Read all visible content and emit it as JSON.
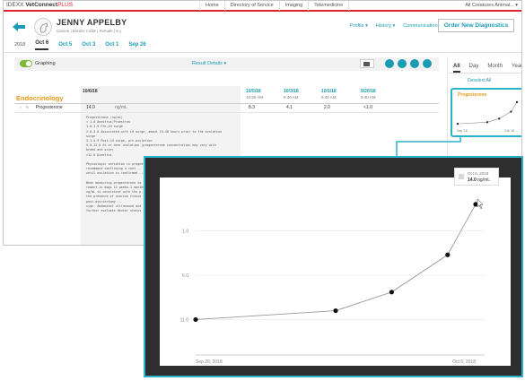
{
  "app": {
    "brand_prefix": "IDEXX",
    "brand_name": "VetConnect",
    "brand_suffix": "PLUS",
    "nav": [
      "Home",
      "Directory of Service",
      "Imaging",
      "Telemedicine"
    ],
    "clinic": "All Creatures Animal... ▾"
  },
  "patient": {
    "name": "JENNY APPELBY",
    "details": "Canine  |  Border Collie  |  Female  |  5 y"
  },
  "header_links": [
    "Profile ▾",
    "History ▾",
    "Communications ▾"
  ],
  "order_button": "Order New Diagnostics",
  "date_tabs": {
    "year": "2018",
    "tabs": [
      "Oct 6",
      "Oct 5",
      "Oct 3",
      "Oct 1",
      "Sep 26"
    ],
    "active": 0
  },
  "toolbar": {
    "graph_label": "Graphing",
    "result_details": "Result Details ▾"
  },
  "section": "Endocrinology",
  "columns": [
    {
      "date": "10/6/18",
      "time": ""
    },
    {
      "date": "10/5/18",
      "time": "10:36 AM"
    },
    {
      "date": "10/3/18",
      "time": "9:40 AM"
    },
    {
      "date": "10/1/18",
      "time": "9:40 AM"
    },
    {
      "date": "9/26/18",
      "time": "9:40 AM"
    }
  ],
  "test": {
    "name": "Progesterone",
    "unit": "ng/mL",
    "values": [
      "14.0",
      "8.3",
      "4.1",
      "2.0",
      "<1.0"
    ]
  },
  "notes": "Progesterone (ng/mL)\n< 1.0 Anestrus/Proestrus\n1.0-1.9 Pre-LH surge\n2.0-3.0 Associated with LH surge, about 24-48 hours prior to the ovulation\nsurge\n3.1-4.9 Post-LH surge, pre-ovulation\n5.0-12.0 At or near ovulation (progesterone concentration may vary with\nbreed and size)\n>12.0 Diestrus\n\nPhysiologic variation in progesterone ...\nrecommend confirming a cont...\nuntil ovulation is confirmed ...\n\nWhen measuring progesterone to ...\nrement in dogs 12 weeks-1 months ...\nng/mL is consistent with the p...\nthe presence of ovarian tissue ...\npost-ovariectomy ...\nsign. Abdominal ultrasound and ...\nfurther evaluate Heuter status ...",
  "right_panel": {
    "tabs": [
      "All",
      "Day",
      "Month",
      "Year"
    ],
    "active_tab": 0,
    "deselect": "Deselect All",
    "card_title": "Progesterone",
    "card_start": "Sep '18",
    "card_end": "Oct '18"
  },
  "zoom_chart": {
    "tooltip_date": "Oct 6, 2018",
    "tooltip_value": "14.0",
    "tooltip_unit": "ng/mL",
    "y_ticks": [
      "11.0",
      "6.0",
      "1.0"
    ],
    "x_start": "Sep 26, 2018",
    "x_end": "Oct 6, 2018"
  },
  "chart_data": {
    "type": "line",
    "title": "Progesterone",
    "xlabel": "",
    "ylabel": "",
    "x": [
      "2018-09-26",
      "2018-10-01",
      "2018-10-03",
      "2018-10-05",
      "2018-10-06"
    ],
    "series": [
      {
        "name": "Progesterone",
        "values": [
          1.0,
          2.0,
          4.1,
          8.3,
          14.0
        ]
      }
    ],
    "y_ticks": [
      1.0,
      6.0,
      11.0
    ],
    "ylim": [
      -3,
      15
    ],
    "grid": true,
    "accent": "#2bb3c9",
    "section_color": "#e29a1d"
  }
}
